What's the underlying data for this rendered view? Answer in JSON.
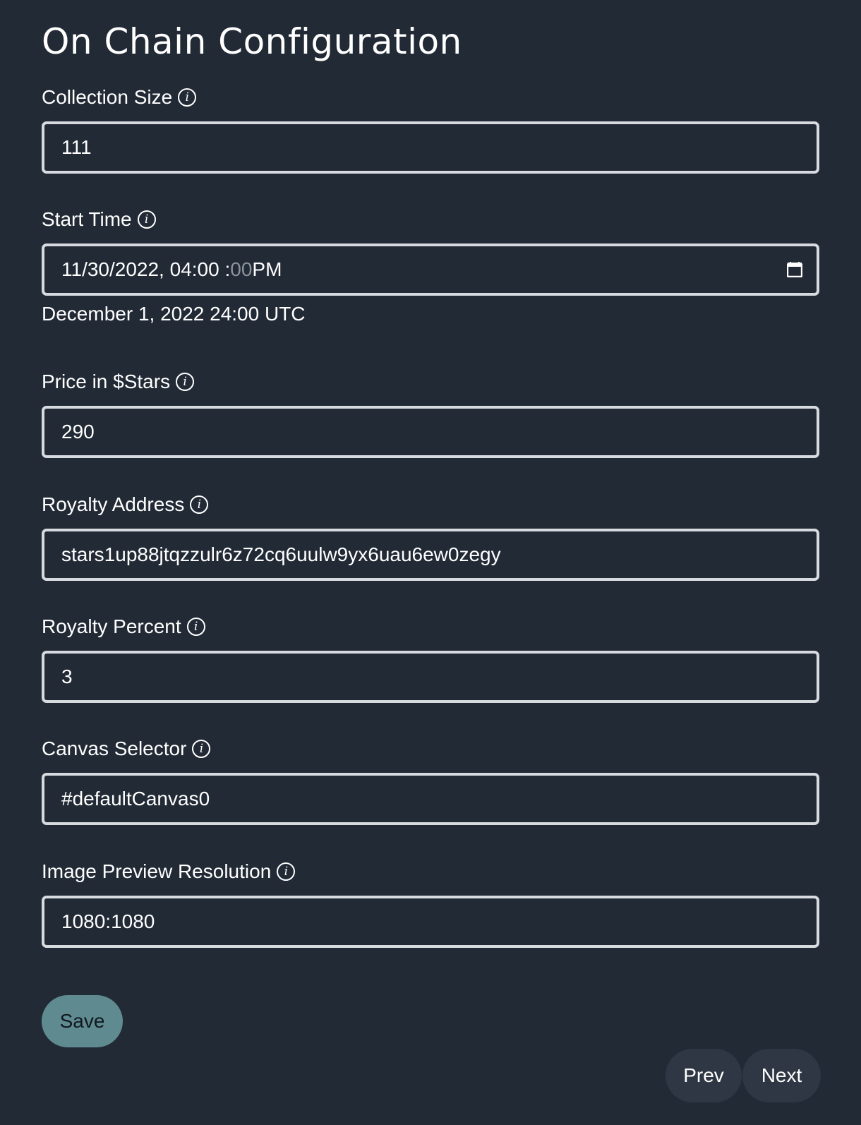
{
  "page": {
    "title": "On Chain Configuration"
  },
  "fields": {
    "collection_size": {
      "label": "Collection Size",
      "value": "111"
    },
    "start_time": {
      "label": "Start Time",
      "date_part": "11/30/2022, 04:00 :",
      "seconds_part": "00",
      "ampm_part": " PM",
      "helper": "December 1, 2022 24:00 UTC"
    },
    "price": {
      "label": "Price in $Stars",
      "value": "290"
    },
    "royalty_address": {
      "label": "Royalty Address",
      "value": "stars1up88jtqzzulr6z72cq6uulw9yx6uau6ew0zegy"
    },
    "royalty_percent": {
      "label": "Royalty Percent",
      "value": "3"
    },
    "canvas_selector": {
      "label": "Canvas Selector",
      "value": "#defaultCanvas0"
    },
    "preview_resolution": {
      "label": "Image Preview Resolution",
      "value": "1080:1080"
    }
  },
  "info_glyph": "i",
  "buttons": {
    "save": "Save",
    "prev": "Prev",
    "next": "Next"
  },
  "colors": {
    "background": "#222a35",
    "input_border": "#d7dadf",
    "save_button": "#5f8b90",
    "nav_button": "#2e3743"
  },
  "icons": {
    "info": "info-icon",
    "calendar": "calendar-icon"
  }
}
